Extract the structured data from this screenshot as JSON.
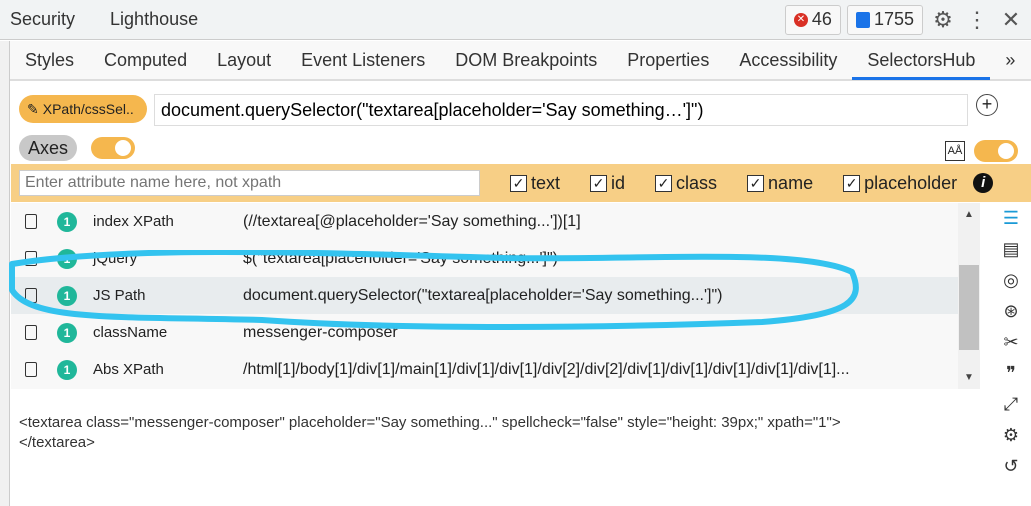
{
  "top": {
    "tabs": [
      "Security",
      "Lighthouse"
    ],
    "errors": "46",
    "messages": "1755"
  },
  "panel_tabs": [
    "Styles",
    "Computed",
    "Layout",
    "Event Listeners",
    "DOM Breakpoints",
    "Properties",
    "Accessibility",
    "SelectorsHub"
  ],
  "active_tab": "SelectorsHub",
  "more": "»",
  "selector": {
    "button": "XPath/cssSel..",
    "value": "document.querySelector(\"textarea[placeholder='Say something…']\")"
  },
  "axes_label": "Axes",
  "attr": {
    "placeholder": "Enter attribute name here, not xpath",
    "checks": [
      "text",
      "id",
      "class",
      "name",
      "placeholder"
    ]
  },
  "rows": [
    {
      "count": "1",
      "label": "index XPath",
      "value": "(//textarea[@placeholder='Say something...'])[1]"
    },
    {
      "count": "1",
      "label": "jQuery",
      "value": "$(\"textarea[placeholder='Say something...']\")"
    },
    {
      "count": "1",
      "label": "JS Path",
      "value": "document.querySelector(\"textarea[placeholder='Say something...']\")"
    },
    {
      "count": "1",
      "label": "className",
      "value": "messenger-composer"
    },
    {
      "count": "1",
      "label": "Abs XPath",
      "value": "/html[1]/body[1]/div[1]/main[1]/div[1]/div[1]/div[2]/div[2]/div[1]/div[1]/div[1]/div[1]/div[1]..."
    }
  ],
  "html_line1": "<textarea class=\"messenger-composer\" placeholder=\"Say something...\" spellcheck=\"false\" style=\"height: 39px;\" xpath=\"1\">",
  "html_line2": "</textarea>",
  "colors": {
    "accent": "#f5b74e",
    "attr_bar": "#f7cf86",
    "count_badge": "#20b79a",
    "annotation": "#33c3ef",
    "active_tab": "#1a73e8"
  }
}
